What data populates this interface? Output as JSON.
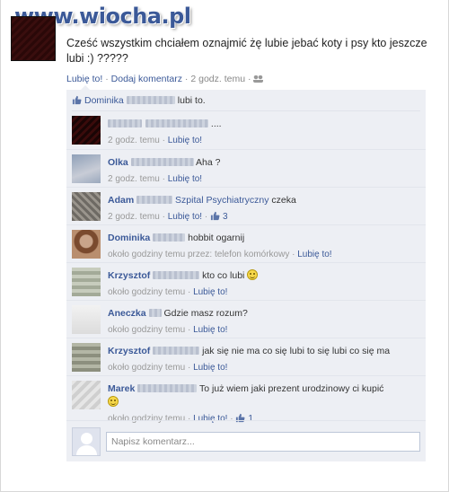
{
  "watermark": {
    "text": "www.wiocha.pl"
  },
  "post": {
    "text": "Cześć wszystkim chciałem oznajmić żę lubie jebać koty i psy kto jeszcze lubi :) ?????",
    "actions": {
      "like": "Lubię to!",
      "sep1": " · ",
      "comment": "Dodaj komentarz",
      "sep2": " · ",
      "time": "2 godz. temu",
      "sep3": " · "
    }
  },
  "likes": {
    "name": "Dominika",
    "suffix": "lubi to."
  },
  "comments": [
    {
      "name": "",
      "text": "....",
      "meta_time": "2 godz. temu",
      "meta_sep": " · ",
      "meta_like": "Lubię to!",
      "likes": ""
    },
    {
      "name": "Olka",
      "text": "Aha ?",
      "meta_time": "2 godz. temu",
      "meta_sep": " · ",
      "meta_like": "Lubię to!",
      "likes": ""
    },
    {
      "name": "Adam",
      "link_text": "Szpital Psychiatryczny",
      "text": "czeka",
      "meta_time": "2 godz. temu",
      "meta_sep": " · ",
      "meta_like": "Lubię to!",
      "likes": "3"
    },
    {
      "name": "Dominika",
      "text": "hobbit ogarnij",
      "meta_time": "około godziny temu przez: telefon komórkowy",
      "meta_sep": " · ",
      "meta_like": "Lubię to!",
      "likes": ""
    },
    {
      "name": "Krzysztof",
      "text": "kto co lubi",
      "meta_time": "około godziny temu",
      "meta_sep": " · ",
      "meta_like": "Lubię to!",
      "likes": ""
    },
    {
      "name": "Aneczka",
      "text": "Gdzie masz rozum?",
      "meta_time": "około godziny temu",
      "meta_sep": " · ",
      "meta_like": "Lubię to!",
      "likes": ""
    },
    {
      "name": "Krzysztof",
      "text": "jak się nie ma co się lubi to się lubi co się ma",
      "meta_time": "około godziny temu",
      "meta_sep": " · ",
      "meta_like": "Lubię to!",
      "likes": ""
    },
    {
      "name": "Marek",
      "text": "To już wiem jaki prezent urodzinowy ci kupić",
      "meta_time": "około godziny temu",
      "meta_sep": " · ",
      "meta_like": "Lubię to!",
      "likes": "1"
    }
  ],
  "input": {
    "placeholder": "Napisz komentarz..."
  },
  "colors": {
    "link": "#3b5998",
    "panel": "#edeff4",
    "border": "#bdc7d8"
  },
  "icons": [
    "thumbs-up-icon",
    "people-icon",
    "smiley-icon",
    "default-avatar-icon"
  ]
}
